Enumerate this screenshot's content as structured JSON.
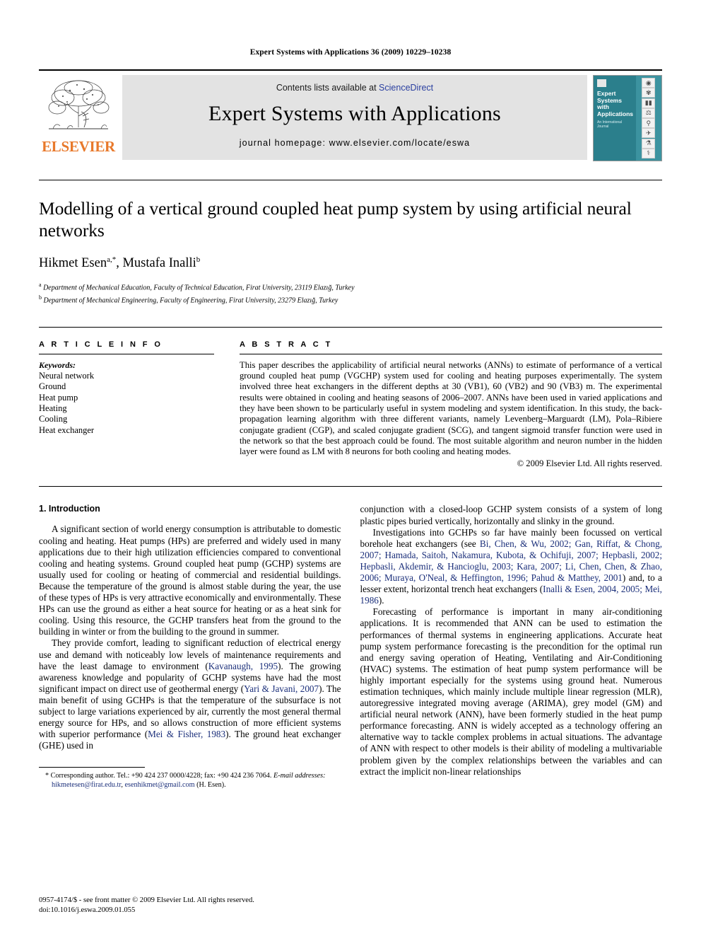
{
  "running_head": "Expert Systems with Applications 36 (2009) 10229–10238",
  "masthead": {
    "publisher": "ELSEVIER",
    "contents_prefix": "Contents lists available at ",
    "contents_link": "ScienceDirect",
    "journal_title": "Expert Systems with Applications",
    "homepage": "journal homepage: www.elsevier.com/locate/eswa",
    "cover": {
      "title": "Expert Systems with Applications",
      "subtitle": "An International Journal",
      "icons": [
        "compass-icon",
        "gear-icon",
        "bar-chart-icon",
        "scales-icon",
        "microscope-icon",
        "satellite-icon",
        "lab-flask-icon",
        "caduceus-icon"
      ]
    }
  },
  "article": {
    "title": "Modelling of a vertical ground coupled heat pump system by using artificial neural networks",
    "authors": "Hikmet Esen a,*, Mustafa Inalli b",
    "authors_parts": [
      {
        "name": "Hikmet Esen",
        "sup": "a,*"
      },
      {
        "name": ", Mustafa Inalli",
        "sup": "b"
      }
    ],
    "affiliations": [
      {
        "marker": "a",
        "text": "Department of Mechanical Education, Faculty of Technical Education, Firat University, 23119 Elazığ, Turkey"
      },
      {
        "marker": "b",
        "text": "Department of Mechanical Engineering, Faculty of Engineering, Firat University, 23279 Elazığ, Turkey"
      }
    ]
  },
  "info": {
    "heading": "A R T I C L E    I N F O",
    "keywords_label": "Keywords:",
    "keywords": [
      "Neural network",
      "Ground",
      "Heat pump",
      "Heating",
      "Cooling",
      "Heat exchanger"
    ]
  },
  "abstract": {
    "heading": "A B S T R A C T",
    "text": "This paper describes the applicability of artificial neural networks (ANNs) to estimate of performance of a vertical ground coupled heat pump (VGCHP) system used for cooling and heating purposes experimentally. The system involved three heat exchangers in the different depths at 30 (VB1), 60 (VB2) and 90 (VB3) m. The experimental results were obtained in cooling and heating seasons of 2006–2007. ANNs have been used in varied applications and they have been shown to be particularly useful in system modeling and system identification. In this study, the back-propagation learning algorithm with three different variants, namely Levenberg–Marguardt (LM), Pola–Ribiere conjugate gradient (CGP), and scaled conjugate gradient (SCG), and tangent sigmoid transfer function were used in the network so that the best approach could be found. The most suitable algorithm and neuron number in the hidden layer were found as LM with 8 neurons for both cooling and heating modes.",
    "copyright": "© 2009 Elsevier Ltd. All rights reserved."
  },
  "body": {
    "section_number_title": "1. Introduction",
    "left_paragraphs": [
      "A significant section of world energy consumption is attributable to domestic cooling and heating. Heat pumps (HPs) are preferred and widely used in many applications due to their high utilization efficiencies compared to conventional cooling and heating systems. Ground coupled heat pump (GCHP) systems are usually used for cooling or heating of commercial and residential buildings. Because the temperature of the ground is almost stable during the year, the use of these types of HPs is very attractive economically and environmentally. These HPs can use the ground as either a heat source for heating or as a heat sink for cooling. Using this resource, the GCHP transfers heat from the ground to the building in winter or from the building to the ground in summer.",
      "They provide comfort, leading to significant reduction of electrical energy use and demand with noticeably low levels of maintenance requirements and have the least damage to environment (Kavanaugh, 1995). The growing awareness knowledge and popularity of GCHP systems have had the most significant impact on direct use of geothermal energy (Yari & Javani, 2007). The main benefit of using GCHPs is that the temperature of the subsurface is not subject to large variations experienced by air, currently the most general thermal energy source for HPs, and so allows construction of more efficient systems with superior performance (Mei & Fisher, 1983). The ground heat exchanger (GHE) used in"
    ],
    "right_paragraphs": [
      "conjunction with a closed-loop GCHP system consists of a system of long plastic pipes buried vertically, horizontally and slinky in the ground.",
      "Investigations into GCHPs so far have mainly been focussed on vertical borehole heat exchangers (see Bi, Chen, & Wu, 2002; Gan, Riffat, & Chong, 2007; Hamada, Saitoh, Nakamura, Kubota, & Ochifuji, 2007; Hepbasli, 2002; Hepbasli, Akdemir, & Hancioglu, 2003; Kara, 2007; Li, Chen, Chen, & Zhao, 2006; Muraya, O'Neal, & Heffington, 1996; Pahud & Matthey, 2001) and, to a lesser extent, horizontal trench heat exchangers (Inalli & Esen, 2004, 2005; Mei, 1986).",
      "Forecasting of performance is important in many air-conditioning applications. It is recommended that ANN can be used to estimation the performances of thermal systems in engineering applications. Accurate heat pump system performance forecasting is the precondition for the optimal run and energy saving operation of Heating, Ventilating and Air-Conditioning (HVAC) systems. The estimation of heat pump system performance will be highly important especially for the systems using ground heat. Numerous estimation techniques, which mainly include multiple linear regression (MLR), autoregressive integrated moving average (ARIMA), grey model (GM) and artificial neural network (ANN), have been formerly studied in the heat pump performance forecasting. ANN is widely accepted as a technology offering an alternative way to tackle complex problems in actual situations. The advantage of ANN with respect to other models is their ability of modeling a multivariable problem given by the complex relationships between the variables and can extract the implicit non-linear relationships"
    ]
  },
  "footnote": {
    "marker": "*",
    "line1": "Corresponding author. Tel.: +90 424 237 0000/4228; fax: +90 424 236 7064.",
    "email_label": "E-mail addresses:",
    "email1": "hikmetesen@firat.edu.tr",
    "email2": "esenhikmet@gmail.com",
    "email_suffix": "(H. Esen)."
  },
  "page_footer": {
    "line1": "0957-4174/$ - see front matter © 2009 Elsevier Ltd. All rights reserved.",
    "line2": "doi:10.1016/j.eswa.2009.01.055"
  },
  "colors": {
    "link": "#2a3fa0",
    "citation": "#1b2f7a",
    "elsevier_orange": "#E8792B",
    "cover_teal": "#2b7f8c",
    "band_gray": "#e3e3e3"
  }
}
